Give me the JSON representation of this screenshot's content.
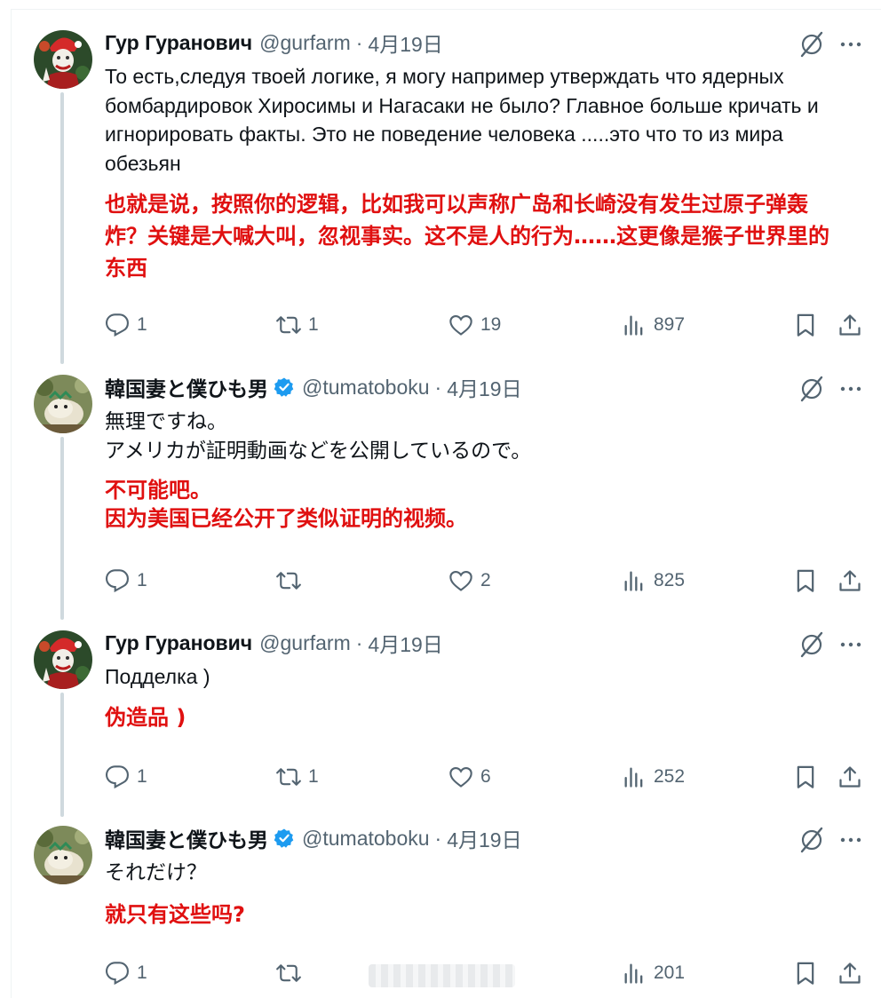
{
  "tweets": [
    {
      "name": "Гур Гуранович",
      "handle": "@gurfarm",
      "date": "4月19日",
      "verified": false,
      "text": "То есть,следуя твоей логике, я могу например утверждать что ядерных\nбомбардировок Хиросимы и Нагасаки не было? Главное больше кричать и\nигнорировать факты. Это не поведение человека .....это что то из мира\nобезьян",
      "translation": "也就是说，按照你的逻辑，比如我可以声称广岛和长崎没有发生过原子弹轰\n炸？关键是大喊大叫，忽视事实。这不是人的行为……这更像是猴子世界里的\n东西",
      "replies": "1",
      "retweets": "1",
      "likes": "19",
      "views": "897"
    },
    {
      "name": "韓国妻と僕ひも男",
      "handle": "@tumatoboku",
      "date": "4月19日",
      "verified": true,
      "text": "無理ですね。\nアメリカが証明動画などを公開しているので。",
      "translation": "不可能吧。\n因为美国已经公开了类似证明的视频。",
      "replies": "1",
      "retweets": "",
      "likes": "2",
      "views": "825"
    },
    {
      "name": "Гур Гуранович",
      "handle": "@gurfarm",
      "date": "4月19日",
      "verified": false,
      "text": "Подделка )",
      "translation": "伪造品 )",
      "replies": "1",
      "retweets": "1",
      "likes": "6",
      "views": "252"
    },
    {
      "name": "韓国妻と僕ひも男",
      "handle": "@tumatoboku",
      "date": "4月19日",
      "verified": true,
      "text": "それだけ？",
      "translation": "就只有这些吗?",
      "replies": "1",
      "retweets": "",
      "likes": "",
      "views": "201"
    }
  ],
  "separator": "·",
  "icons": {
    "reply": "reply-icon",
    "retweet": "retweet-icon",
    "like": "heart-icon",
    "views": "views-icon",
    "bookmark": "bookmark-icon",
    "share": "share-icon",
    "grok": "grok-icon",
    "more": "more-icon",
    "verified": "verified-badge-icon"
  },
  "colors": {
    "translation": "#e01010",
    "secondary": "#536471",
    "verified": "#1d9bf0",
    "thread_line": "#cfd9de"
  }
}
